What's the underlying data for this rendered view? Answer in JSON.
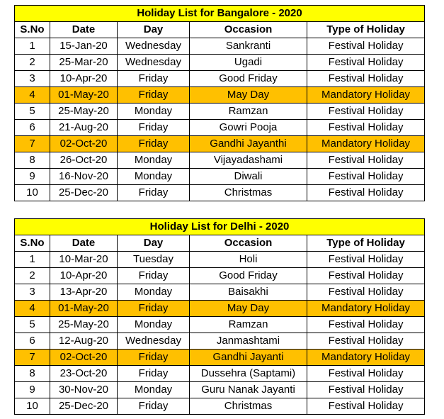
{
  "colors": {
    "title_bg": "#ffff00",
    "mandatory_bg": "#ffc000"
  },
  "tables": [
    {
      "title": "Holiday List for Bangalore - 2020",
      "headers": [
        "S.No",
        "Date",
        "Day",
        "Occasion",
        "Type of Holiday"
      ],
      "rows": [
        [
          "1",
          "15-Jan-20",
          "Wednesday",
          "Sankranti",
          "Festival Holiday"
        ],
        [
          "2",
          "25-Mar-20",
          "Wednesday",
          "Ugadi",
          "Festival Holiday"
        ],
        [
          "3",
          "10-Apr-20",
          "Friday",
          "Good Friday",
          "Festival Holiday"
        ],
        [
          "4",
          "01-May-20",
          "Friday",
          "May Day",
          "Mandatory Holiday"
        ],
        [
          "5",
          "25-May-20",
          "Monday",
          "Ramzan",
          "Festival Holiday"
        ],
        [
          "6",
          "21-Aug-20",
          "Friday",
          "Gowri Pooja",
          "Festival Holiday"
        ],
        [
          "7",
          "02-Oct-20",
          "Friday",
          "Gandhi Jayanthi",
          "Mandatory Holiday"
        ],
        [
          "8",
          "26-Oct-20",
          "Monday",
          "Vijayadashami",
          "Festival Holiday"
        ],
        [
          "9",
          "16-Nov-20",
          "Monday",
          "Diwali",
          "Festival Holiday"
        ],
        [
          "10",
          "25-Dec-20",
          "Friday",
          "Christmas",
          "Festival Holiday"
        ]
      ]
    },
    {
      "title": "Holiday List for Delhi - 2020",
      "headers": [
        "S.No",
        "Date",
        "Day",
        "Occasion",
        "Type of Holiday"
      ],
      "rows": [
        [
          "1",
          "10-Mar-20",
          "Tuesday",
          "Holi",
          "Festival Holiday"
        ],
        [
          "2",
          "10-Apr-20",
          "Friday",
          "Good Friday",
          "Festival Holiday"
        ],
        [
          "3",
          "13-Apr-20",
          "Monday",
          "Baisakhi",
          "Festival Holiday"
        ],
        [
          "4",
          "01-May-20",
          "Friday",
          "May Day",
          "Mandatory Holiday"
        ],
        [
          "5",
          "25-May-20",
          "Monday",
          "Ramzan",
          "Festival Holiday"
        ],
        [
          "6",
          "12-Aug-20",
          "Wednesday",
          "Janmashtami",
          "Festival Holiday"
        ],
        [
          "7",
          "02-Oct-20",
          "Friday",
          "Gandhi Jayanti",
          "Mandatory Holiday"
        ],
        [
          "8",
          "23-Oct-20",
          "Friday",
          "Dussehra (Saptami)",
          "Festival Holiday"
        ],
        [
          "9",
          "30-Nov-20",
          "Monday",
          "Guru Nanak Jayanti",
          "Festival Holiday"
        ],
        [
          "10",
          "25-Dec-20",
          "Friday",
          "Christmas",
          "Festival Holiday"
        ]
      ]
    }
  ]
}
